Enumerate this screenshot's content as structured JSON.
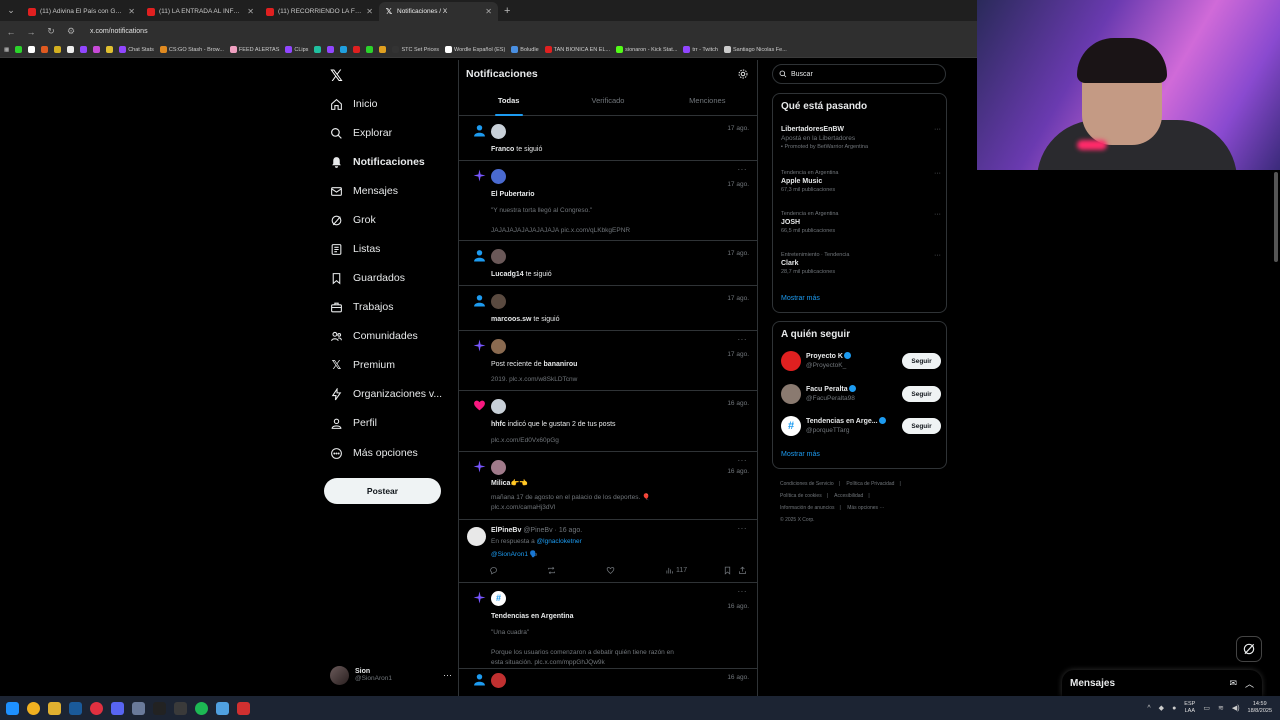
{
  "browser": {
    "tabs": [
      {
        "title": "(11) Adivina El País con Gaspi",
        "active": false,
        "favicon": "youtube"
      },
      {
        "title": "(11) LA ENTRADA AL INFRAMUNDO",
        "active": false,
        "favicon": "youtube"
      },
      {
        "title": "(11) RECORRIENDO LA FERIA DE",
        "active": false,
        "favicon": "youtube"
      },
      {
        "title": "Notificaciones / X",
        "active": true,
        "favicon": "x"
      }
    ],
    "url": "x.com/notifications",
    "bookmarks": [
      "Chat Stats",
      "CS:GO Stash - Brow...",
      "FEED ALERTAS",
      "CLips",
      "STC Set Prices",
      "Wordle Español (ES)",
      "Boludle",
      "TAN BIONICA EN EL...",
      "sionaron - Kick Stat...",
      "trr - Twitch",
      "Santiago Nicolas Fe..."
    ]
  },
  "left_nav": {
    "items": [
      {
        "label": "Inicio",
        "icon": "home-icon"
      },
      {
        "label": "Explorar",
        "icon": "search-icon"
      },
      {
        "label": "Notificaciones",
        "icon": "bell-icon",
        "active": true
      },
      {
        "label": "Mensajes",
        "icon": "mail-icon"
      },
      {
        "label": "Grok",
        "icon": "grok-icon"
      },
      {
        "label": "Listas",
        "icon": "list-icon"
      },
      {
        "label": "Guardados",
        "icon": "bookmark-icon"
      },
      {
        "label": "Trabajos",
        "icon": "briefcase-icon"
      },
      {
        "label": "Comunidades",
        "icon": "people-icon"
      },
      {
        "label": "Premium",
        "icon": "x-icon"
      },
      {
        "label": "Organizaciones v...",
        "icon": "lightning-icon"
      },
      {
        "label": "Perfil",
        "icon": "person-icon"
      },
      {
        "label": "Más opciones",
        "icon": "more-circle-icon"
      }
    ],
    "post_label": "Postear",
    "account": {
      "name": "Sion",
      "handle": "@SionAron1"
    }
  },
  "main": {
    "title": "Notificaciones",
    "tabs": [
      "Todas",
      "Verificado",
      "Menciones"
    ],
    "notifications": [
      {
        "actor": "Franco",
        "action": " te siguió",
        "time": "17 ago."
      },
      {
        "actor": "El Pubertario",
        "action": "",
        "time": "17 ago.",
        "quote": "\"Y nuestra torta llegó al Congreso.\"",
        "sub": "JAJAJAJAJAJAJAJAJA pic.x.com/qLKbkgEPNR"
      },
      {
        "actor": "Lucadg14",
        "action": " te siguió",
        "time": "17 ago."
      },
      {
        "actor": "marcoos.sw",
        "action": " te siguió",
        "time": "17 ago."
      },
      {
        "prefix": "Post reciente de ",
        "actor": "bananirou",
        "time": "17 ago.",
        "sub": "2019. plc.x.com/w8SkLDTcnw"
      },
      {
        "actor": "hhfc",
        "action": " indicó que le gustan 2 de tus posts",
        "time": "16 ago.",
        "sub": "plc.x.com/Ed0Vx60pGg"
      },
      {
        "actor": "Milica",
        "action": "👉👈",
        "time": "16 ago.",
        "sub": "mañana 17 de agosto en el palacio de los deportes. 🎈",
        "sub2": "plc.x.com/camaHj3dVl"
      }
    ],
    "reply": {
      "name": "ElPineBv",
      "meta": "@PineBv · 16 ago.",
      "reply_to_prefix": "En respuesta a ",
      "reply_to": "@lgnacloketner",
      "mention": "@SionAron1 🗣️",
      "views": "117"
    },
    "trend_notif": {
      "actor": "Tendencias en Argentina",
      "time": "16 ago.",
      "quote": "\"Una cuadra\"",
      "sub": "Porque los usuarios comenzaron a debatir quién tiene razón en",
      "sub2": "esta situación. plc.x.com/mppGhJQw9k"
    },
    "last_time": "16 ago."
  },
  "right": {
    "search_placeholder": "Buscar",
    "trends_title": "Qué está pasando",
    "trends": [
      {
        "context": "",
        "name": "LibertadoresEnBW",
        "count": "Apostá en la Libertadores",
        "promo": "Promoted by BetWarrior Argentina"
      },
      {
        "context": "Tendencia en Argentina",
        "name": "Apple Music",
        "count": "67,3 mil publicaciones"
      },
      {
        "context": "Tendencia en Argentina",
        "name": "JOSH",
        "count": "66,5 mil publicaciones"
      },
      {
        "context": "Entretenimiento · Tendencia",
        "name": "Clark",
        "count": "28,7 mil publicaciones"
      }
    ],
    "show_more": "Mostrar más",
    "follow_title": "A quién seguir",
    "follow": [
      {
        "name": "Proyecto K",
        "handle": "@ProyectoK_",
        "button": "Seguir"
      },
      {
        "name": "Facu Peralta",
        "handle": "@FacuPeralta98",
        "button": "Seguir"
      },
      {
        "name": "Tendencias en Arge...",
        "handle": "@porqueTTarg",
        "button": "Seguir"
      }
    ],
    "footer": [
      "Condiciones de Servicio",
      "Política de Privacidad",
      "Política de cookies",
      "Accesibilidad",
      "Información de anuncios",
      "Más opciones ···",
      "© 2025 X Corp."
    ]
  },
  "messages_drawer": {
    "title": "Mensajes"
  },
  "taskbar": {
    "lang": "ESP",
    "lang2": "LAA",
    "time": "14:59",
    "date": "18/8/2025"
  },
  "colors": {
    "accent": "#1d9bf0",
    "like": "#f91880",
    "sparkle": "#7856ff",
    "background": "#000000",
    "border": "#2f3336"
  }
}
